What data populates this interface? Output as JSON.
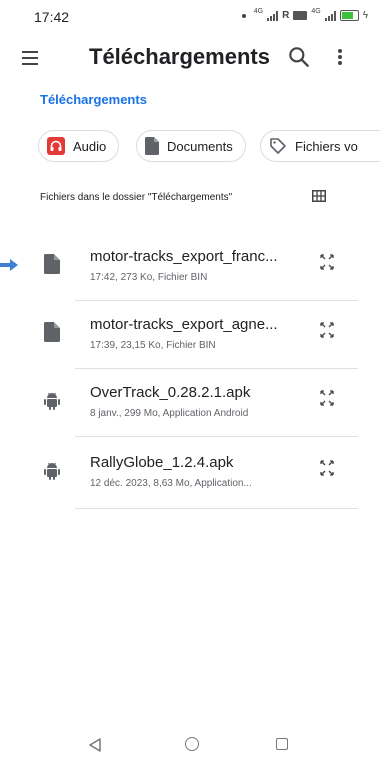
{
  "status_bar": {
    "time": "17:42",
    "network_label_1": "4G",
    "roaming_badge": "R",
    "network_label_2": "4G",
    "battery_color": "#3cc13b"
  },
  "app_bar": {
    "title": "Téléchargements",
    "menu_icon": "hamburger-menu-icon",
    "search_icon": "search-icon",
    "more_icon": "more-vert-icon"
  },
  "breadcrumb": "Téléchargements",
  "chips": [
    {
      "label": "Audio",
      "icon": "audio-icon",
      "icon_color": "#e53935"
    },
    {
      "label": "Documents",
      "icon": "document-icon"
    },
    {
      "label": "Fichiers vo",
      "icon": "tag-icon"
    }
  ],
  "section_label": "Fichiers dans le dossier \"Téléchargements\"",
  "view_toggle_icon": "grid-view-icon",
  "files": [
    {
      "name": "motor-tracks_export_franc...",
      "meta": "17:42, 273 Ko, Fichier BIN",
      "icon": "file-icon"
    },
    {
      "name": "motor-tracks_export_agne...",
      "meta": "17:39, 23,15 Ko, Fichier BIN",
      "icon": "file-icon"
    },
    {
      "name": "OverTrack_0.28.2.1.apk",
      "meta": "8 janv., 299 Mo, Application Android",
      "icon": "android-icon"
    },
    {
      "name": "RallyGlobe_1.2.4.apk",
      "meta": "12 déc. 2023, 8,63 Mo, Application...",
      "icon": "android-icon"
    }
  ],
  "colors": {
    "accent": "#1a73e8",
    "text_primary": "#202124",
    "text_secondary": "#5f6368",
    "icon_gray": "#5f6368",
    "marker_arrow": "#3f7fd4"
  },
  "nav_bar": {
    "back_icon": "back-triangle-icon",
    "home_icon": "home-circle-icon",
    "recents_icon": "recents-square-icon"
  }
}
